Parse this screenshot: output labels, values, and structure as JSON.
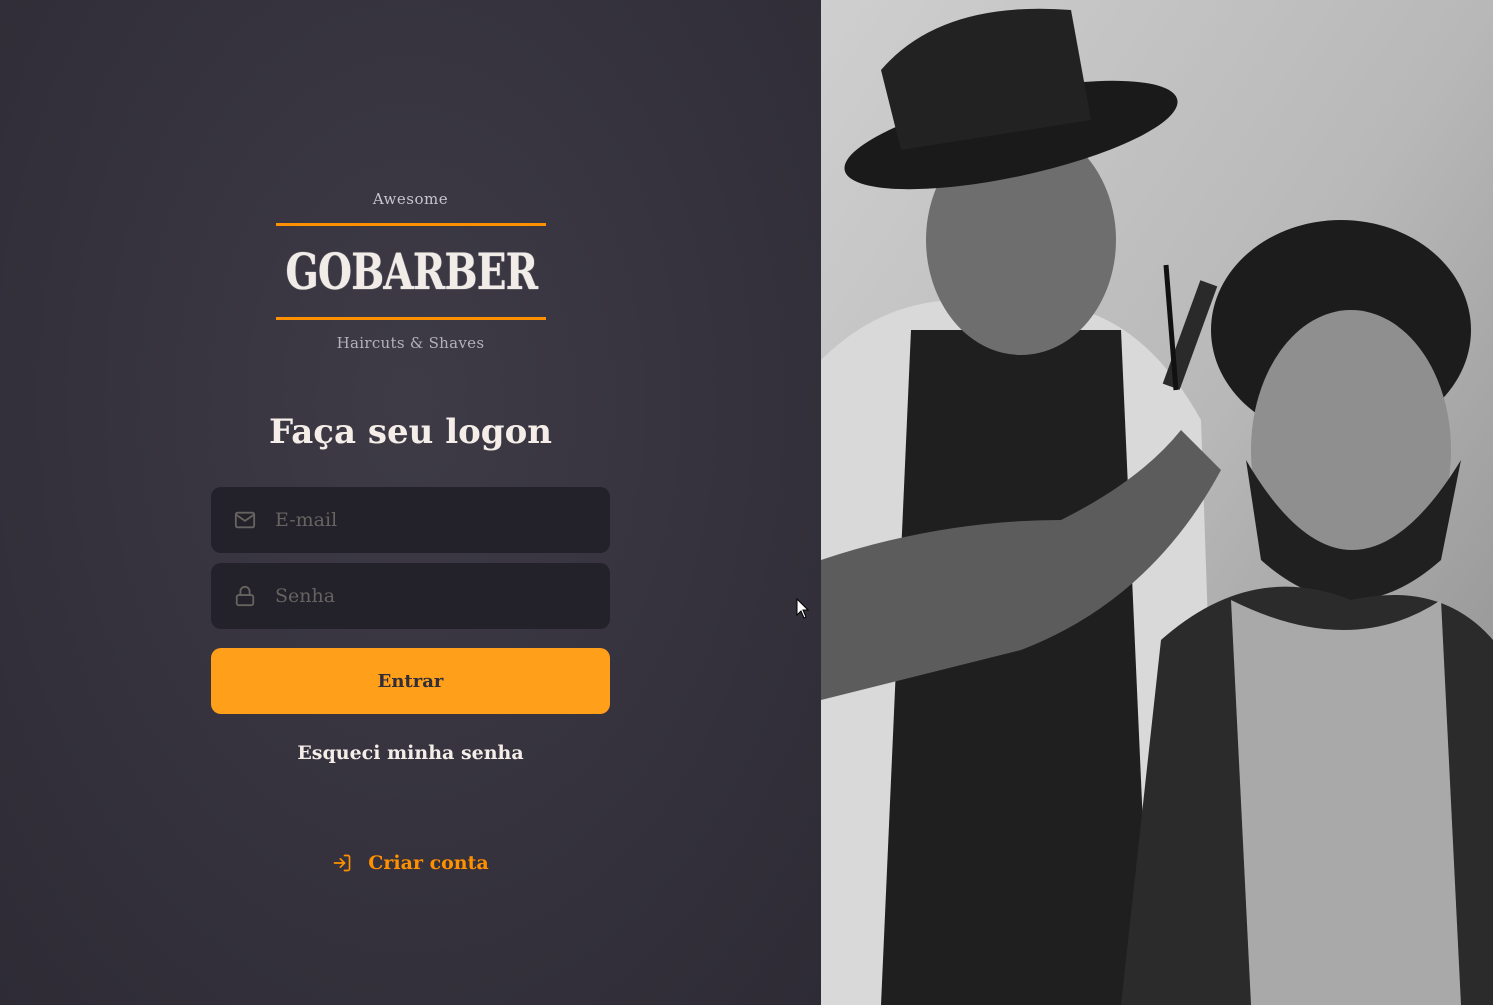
{
  "brand": {
    "top_text": "Awesome",
    "name": "GOBARBER",
    "sub_text": "Haircuts & Shaves",
    "accent": "#ff9000"
  },
  "form": {
    "title": "Faça seu logon",
    "email": {
      "placeholder": "E-mail",
      "value": "",
      "icon": "mail-icon"
    },
    "password": {
      "placeholder": "Senha",
      "value": "",
      "icon": "lock-icon"
    },
    "submit_label": "Entrar",
    "forgot_label": "Esqueci minha senha"
  },
  "signup": {
    "label": "Criar conta",
    "icon": "log-in-icon"
  },
  "colors": {
    "background": "#312e38",
    "input_background": "#232129",
    "placeholder": "#666360",
    "button": "#ff9f1a",
    "text": "#f4ede8"
  },
  "hero": {
    "image": "barber-photo",
    "style": "black-and-white"
  }
}
